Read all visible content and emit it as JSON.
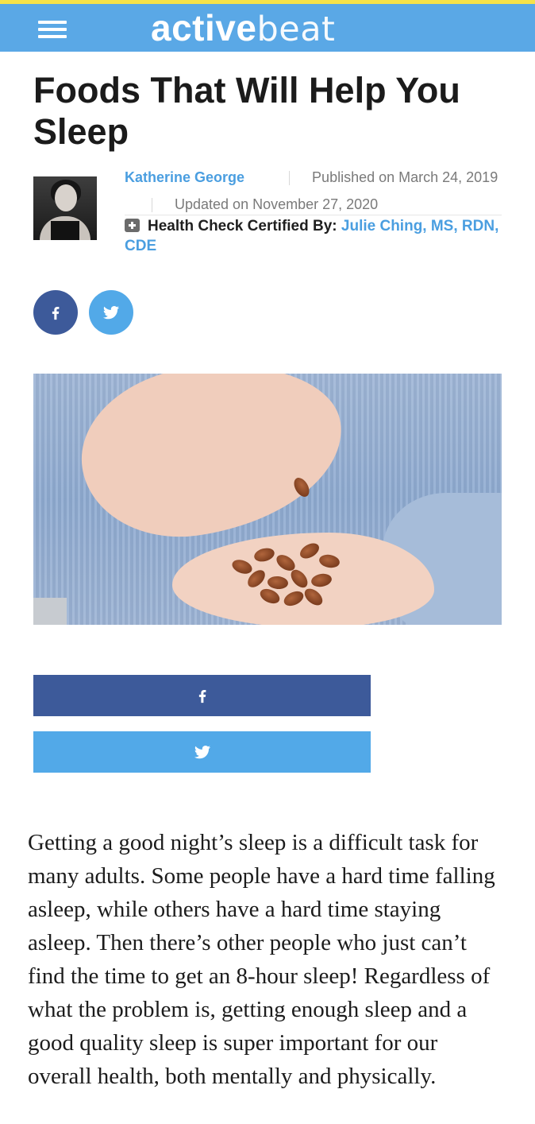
{
  "header": {
    "logo_active": "activ",
    "logo_letter": "e",
    "logo_beat": "beat",
    "accent_color": "#5aa8e6",
    "stripe_color": "#f6e24a",
    "menu_icon": "hamburger-menu-icon"
  },
  "article": {
    "title": "Foods That Will Help You Sleep",
    "author": "Katherine George",
    "published": "Published on March 24, 2019",
    "updated": "Updated on November 27, 2020",
    "certified_label": "Health Check Certified By:",
    "certified_by": "Julie Ching, MS, RDN, CDE",
    "body": "Getting a good night’s sleep is a difficult task for many adults. Some people have a hard time falling asleep, while others have a hard time staying asleep. Then there’s other people who just can’t find the time to get an 8-hour sleep! Regardless of what the problem is, getting enough sleep and a good quality sleep is super important for our overall health, both mentally and physically."
  },
  "social": {
    "facebook_color": "#3d5a9a",
    "twitter_color": "#52a9e8",
    "icons": [
      "facebook-icon",
      "twitter-icon"
    ]
  }
}
